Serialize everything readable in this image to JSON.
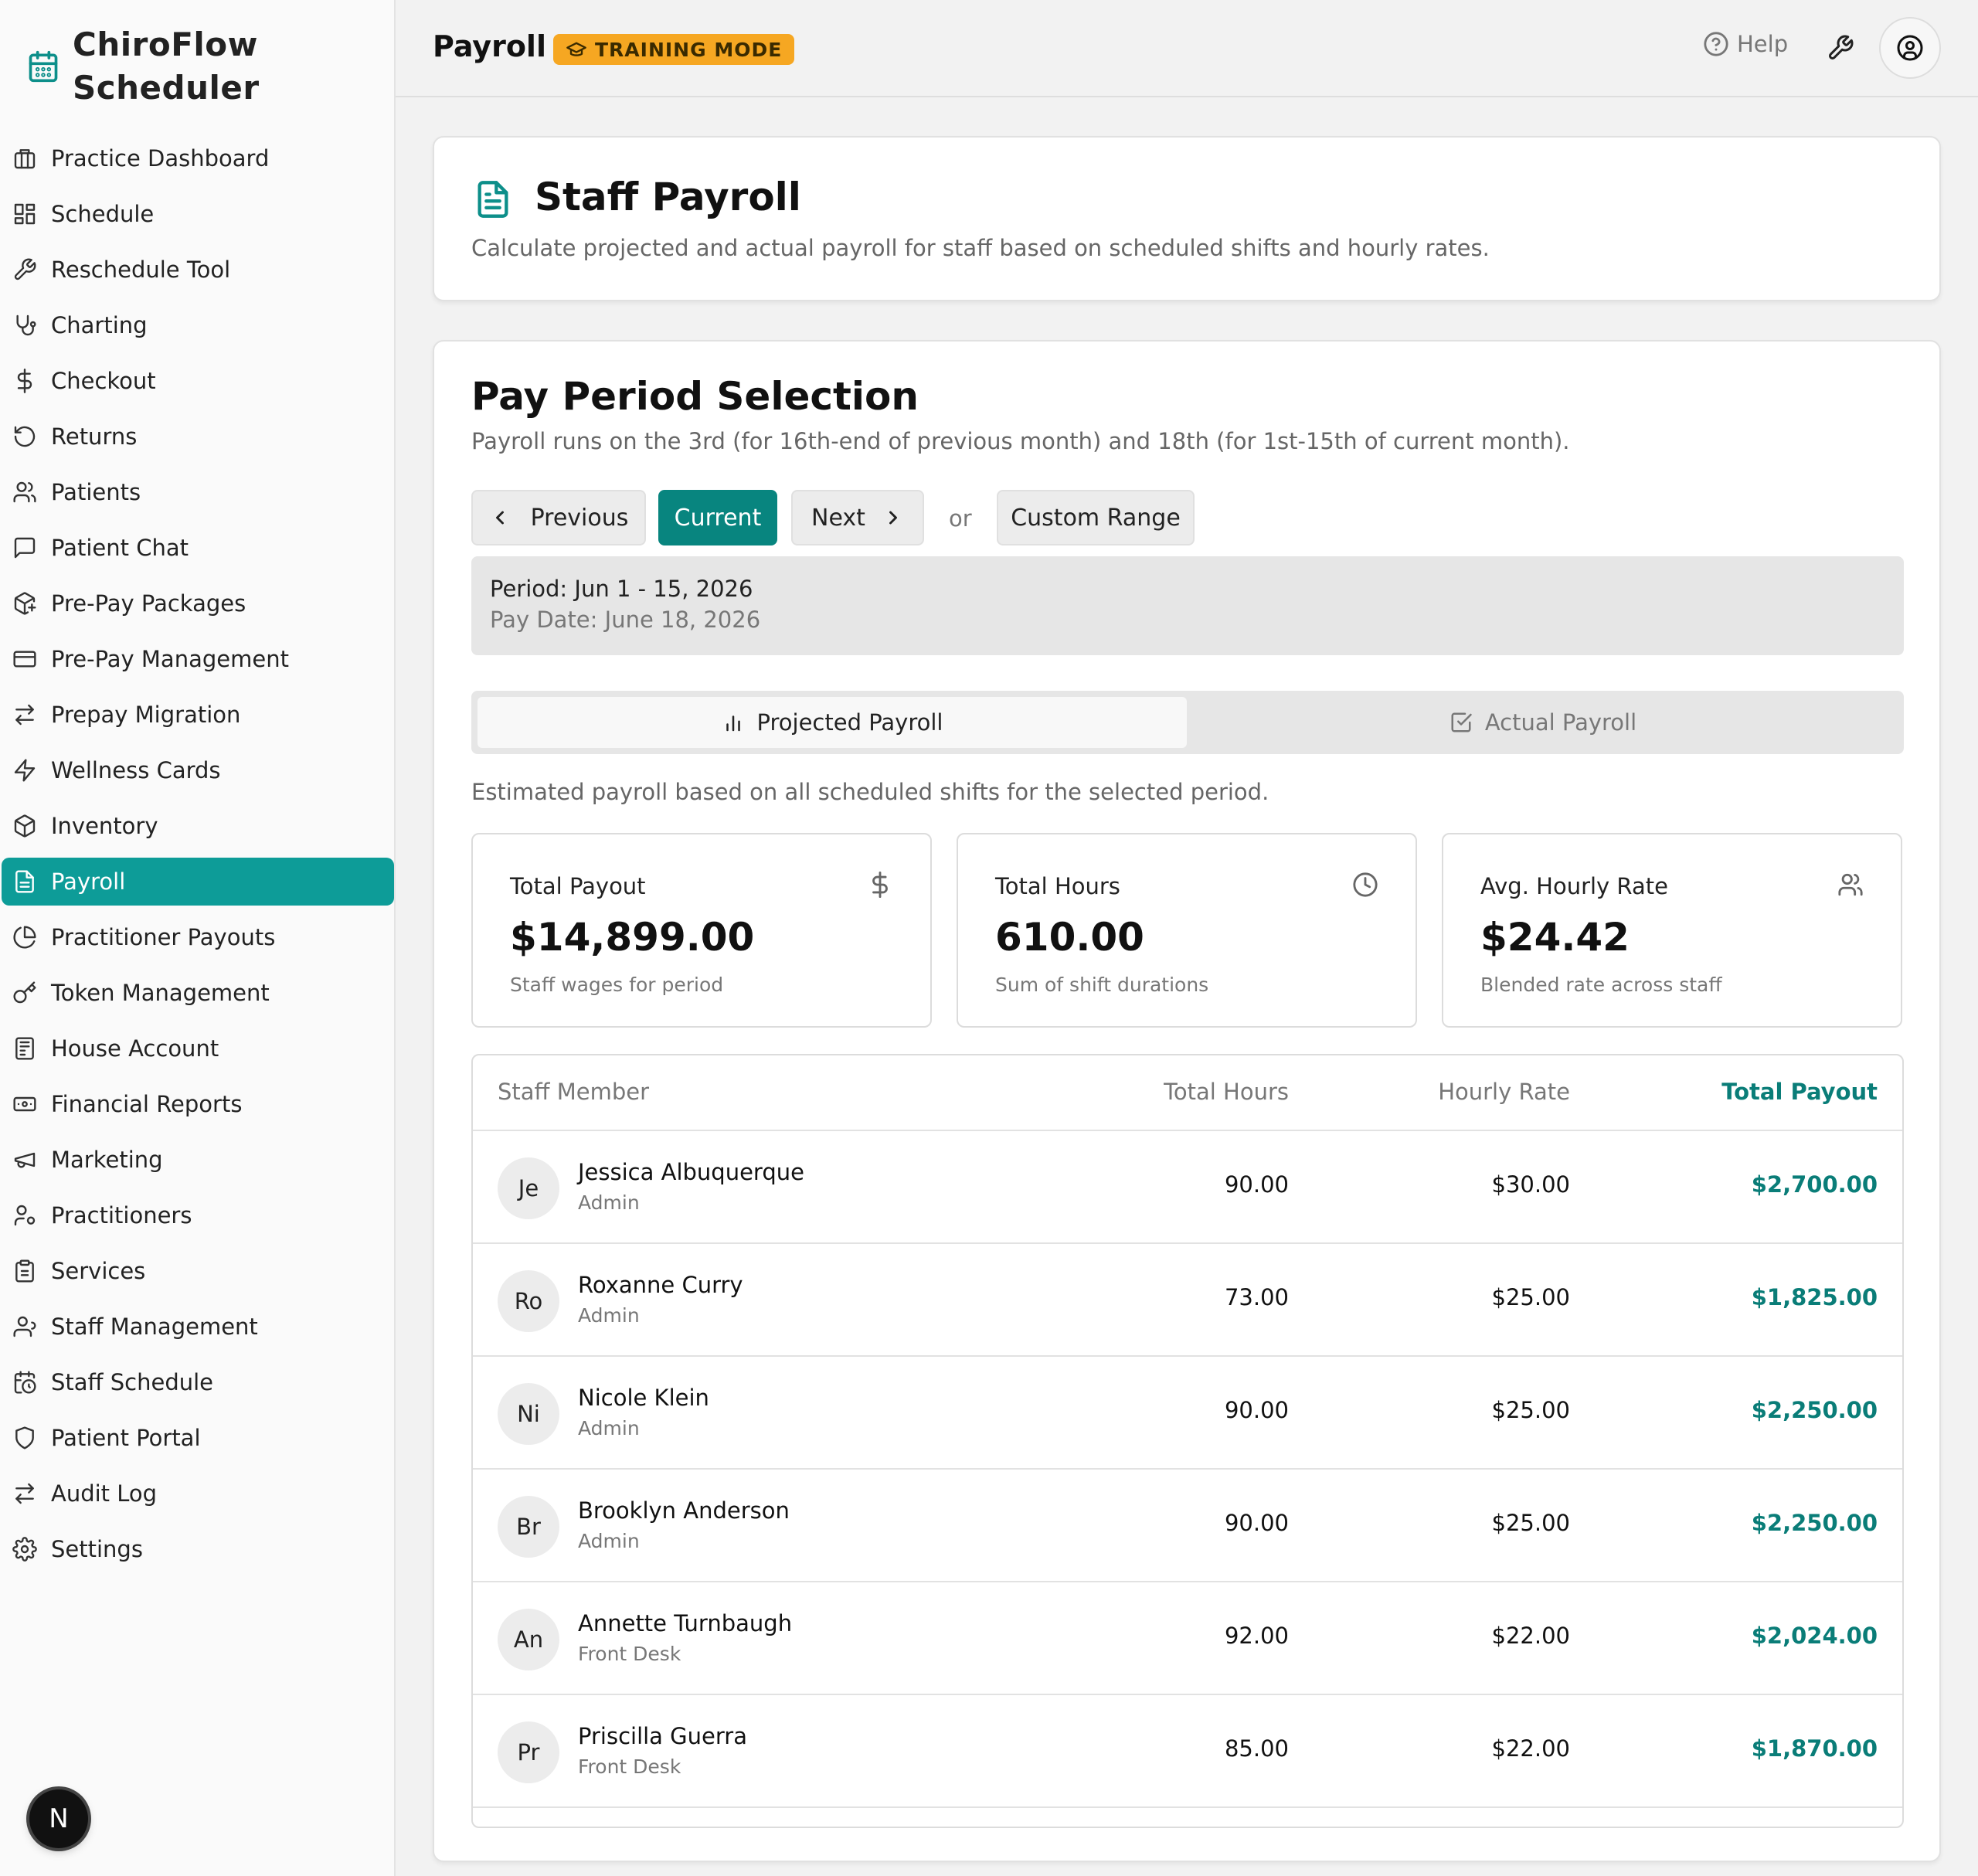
{
  "app": {
    "name": "ChiroFlow Scheduler",
    "name_line1": "ChiroFlow",
    "name_line2": "Scheduler",
    "accent": "#0d9c98"
  },
  "sidebar": {
    "items": [
      {
        "label": "Practice Dashboard",
        "icon": "building-icon"
      },
      {
        "label": "Schedule",
        "icon": "grid-icon"
      },
      {
        "label": "Reschedule Tool",
        "icon": "wrench-icon"
      },
      {
        "label": "Charting",
        "icon": "stethoscope-icon"
      },
      {
        "label": "Checkout",
        "icon": "dollar-icon"
      },
      {
        "label": "Returns",
        "icon": "undo-icon"
      },
      {
        "label": "Patients",
        "icon": "users-icon"
      },
      {
        "label": "Patient Chat",
        "icon": "chat-icon"
      },
      {
        "label": "Pre-Pay Packages",
        "icon": "package-plus-icon"
      },
      {
        "label": "Pre-Pay Management",
        "icon": "credit-card-icon"
      },
      {
        "label": "Prepay Migration",
        "icon": "arrows-swap-icon"
      },
      {
        "label": "Wellness Cards",
        "icon": "lightning-icon"
      },
      {
        "label": "Inventory",
        "icon": "box-icon"
      },
      {
        "label": "Payroll",
        "icon": "document-icon",
        "active": true
      },
      {
        "label": "Practitioner Payouts",
        "icon": "pie-chart-icon"
      },
      {
        "label": "Token Management",
        "icon": "key-icon"
      },
      {
        "label": "House Account",
        "icon": "ledger-icon"
      },
      {
        "label": "Financial Reports",
        "icon": "banknote-icon"
      },
      {
        "label": "Marketing",
        "icon": "megaphone-icon"
      },
      {
        "label": "Practitioners",
        "icon": "user-cog-icon"
      },
      {
        "label": "Services",
        "icon": "clipboard-icon"
      },
      {
        "label": "Staff Management",
        "icon": "staff-icon"
      },
      {
        "label": "Staff Schedule",
        "icon": "calendar-clock-icon"
      },
      {
        "label": "Patient Portal",
        "icon": "shield-icon"
      },
      {
        "label": "Audit Log",
        "icon": "arrows-swap-icon"
      },
      {
        "label": "Settings",
        "icon": "gear-icon"
      }
    ],
    "footer_badge": "N"
  },
  "topbar": {
    "title": "Payroll",
    "badge": "TRAINING MODE",
    "badge_color": "#f6a722",
    "help": "Help"
  },
  "header": {
    "title": "Staff Payroll",
    "subtitle": "Calculate projected and actual payroll for staff based on scheduled shifts and hourly rates."
  },
  "period": {
    "title": "Pay Period Selection",
    "subtitle": "Payroll runs on the 3rd (for 16th-end of previous month) and 18th (for 1st-15th of current month).",
    "prev_label": "Previous",
    "current_label": "Current",
    "next_label": "Next",
    "or_label": "or",
    "custom_label": "Custom Range",
    "period_text": "Period: Jun 1 - 15, 2026",
    "pay_date_text": "Pay Date: June 18, 2026"
  },
  "tabs": {
    "projected": "Projected Payroll",
    "actual": "Actual Payroll"
  },
  "estimate_note": "Estimated payroll based on all scheduled shifts for the selected period.",
  "stats": [
    {
      "label": "Total Payout",
      "value": "$14,899.00",
      "note": "Staff wages for period",
      "icon": "dollar-icon"
    },
    {
      "label": "Total Hours",
      "value": "610.00",
      "note": "Sum of shift durations",
      "icon": "clock-icon"
    },
    {
      "label": "Avg. Hourly Rate",
      "value": "$24.42",
      "note": "Blended rate across staff",
      "icon": "users-icon"
    }
  ],
  "table": {
    "headers": {
      "staff": "Staff Member",
      "hours": "Total Hours",
      "rate": "Hourly Rate",
      "payout": "Total Payout"
    },
    "rows": [
      {
        "initials": "Je",
        "name": "Jessica Albuquerque",
        "role": "Admin",
        "hours": "90.00",
        "rate": "$30.00",
        "payout": "$2,700.00"
      },
      {
        "initials": "Ro",
        "name": "Roxanne Curry",
        "role": "Admin",
        "hours": "73.00",
        "rate": "$25.00",
        "payout": "$1,825.00"
      },
      {
        "initials": "Ni",
        "name": "Nicole Klein",
        "role": "Admin",
        "hours": "90.00",
        "rate": "$25.00",
        "payout": "$2,250.00"
      },
      {
        "initials": "Br",
        "name": "Brooklyn Anderson",
        "role": "Admin",
        "hours": "90.00",
        "rate": "$25.00",
        "payout": "$2,250.00"
      },
      {
        "initials": "An",
        "name": "Annette Turnbaugh",
        "role": "Front Desk",
        "hours": "92.00",
        "rate": "$22.00",
        "payout": "$2,024.00"
      },
      {
        "initials": "Pr",
        "name": "Priscilla Guerra",
        "role": "Front Desk",
        "hours": "85.00",
        "rate": "$22.00",
        "payout": "$1,870.00"
      }
    ]
  }
}
